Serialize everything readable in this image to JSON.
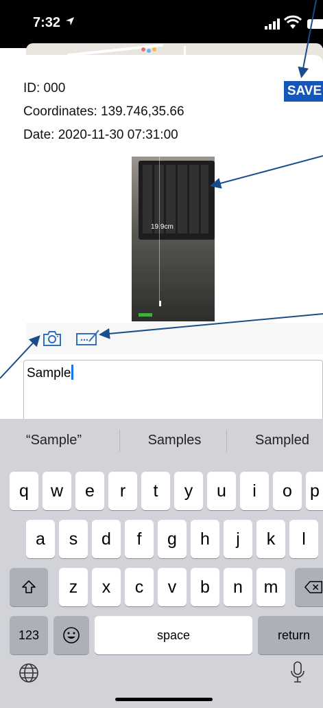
{
  "status_bar": {
    "time": "7:32"
  },
  "info": {
    "id": "ID: 000",
    "coordinates": "Coordinates: 139.746,35.66",
    "date": "Date: 2020-11-30 07:31:00"
  },
  "save_label": "SAVE",
  "photo": {
    "measure_label": "19.9cm"
  },
  "memo": {
    "text": "Sample"
  },
  "suggestions": [
    "“Sample”",
    "Samples",
    "Sampled"
  ],
  "keyboard": {
    "row1": [
      "q",
      "w",
      "e",
      "r",
      "t",
      "y",
      "u",
      "i",
      "o",
      "p"
    ],
    "row2": [
      "a",
      "s",
      "d",
      "f",
      "g",
      "h",
      "j",
      "k",
      "l"
    ],
    "row3": [
      "z",
      "x",
      "c",
      "v",
      "b",
      "n",
      "m"
    ],
    "numbers_key": "123",
    "space_key": "space",
    "return_key": "return"
  },
  "icons": {
    "camera": "camera-icon",
    "edit": "edit-icon",
    "shift": "shift-icon",
    "delete": "delete-icon",
    "emoji": "emoji-icon",
    "globe": "globe-icon",
    "microphone": "microphone-icon"
  },
  "colors": {
    "save_bg": "#1457b8",
    "annotation": "#1a4b8c",
    "icon_blue": "#2e6fc2"
  }
}
